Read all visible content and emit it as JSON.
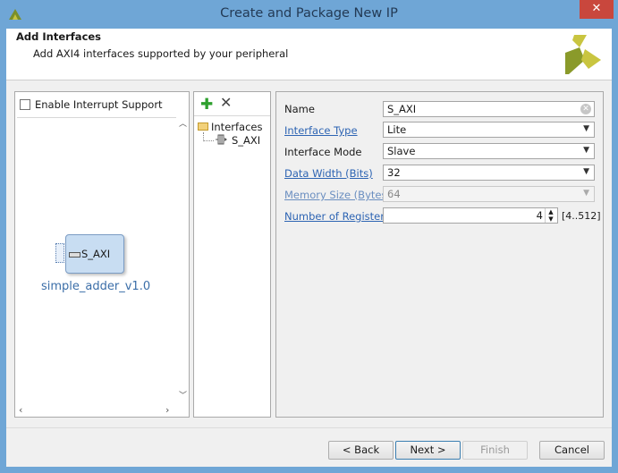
{
  "window": {
    "title": "Create and Package New IP",
    "close_glyph": "✕"
  },
  "header": {
    "title": "Add Interfaces",
    "subtitle": "Add AXI4 interfaces supported by your peripheral"
  },
  "left_panel": {
    "enable_interrupt_label": "Enable Interrupt Support",
    "enable_interrupt_checked": false,
    "ip_block": {
      "port_label": "S_AXI",
      "name": "simple_adder_v1.0"
    }
  },
  "tree": {
    "add_glyph": "✚",
    "remove_glyph": "✕",
    "folder_label": "Interfaces",
    "item_label": "S_AXI"
  },
  "form": {
    "name": {
      "label": "Name",
      "value": "S_AXI"
    },
    "interface_type": {
      "label": "Interface Type",
      "value": "Lite"
    },
    "interface_mode": {
      "label": "Interface Mode",
      "value": "Slave"
    },
    "data_width": {
      "label": "Data Width (Bits)",
      "value": "32"
    },
    "memory_size": {
      "label": "Memory Size (Bytes)",
      "value": "64"
    },
    "num_registers": {
      "label": "Number of Registers",
      "value": "4",
      "range": "[4..512]"
    }
  },
  "buttons": {
    "back": "< Back",
    "next": "Next >",
    "finish": "Finish",
    "cancel": "Cancel"
  },
  "colors": {
    "title_bar": "#6fa6d6",
    "close": "#c9473d",
    "link": "#2d64b3"
  }
}
